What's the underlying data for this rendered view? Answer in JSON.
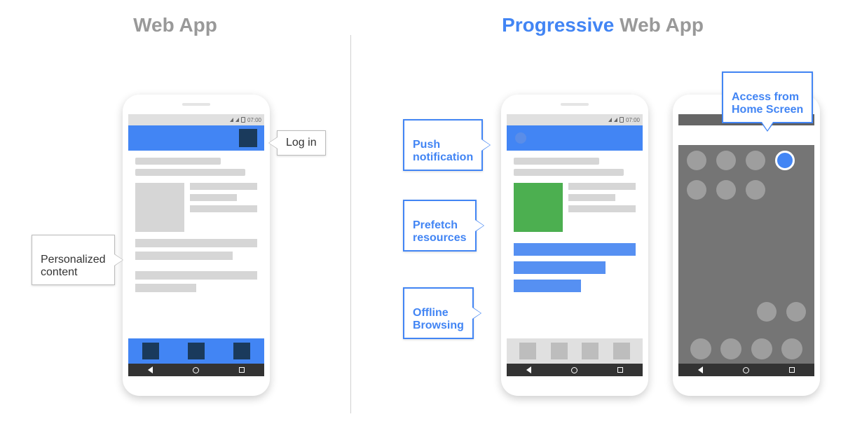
{
  "headings": {
    "left": "Web App",
    "right_highlight": "Progressive",
    "right_rest": " Web App"
  },
  "status": {
    "time": "07:00"
  },
  "callouts": {
    "login": "Log in",
    "personalized": "Personalized\ncontent",
    "push": "Push\nnotification",
    "prefetch": "Prefetch\nresources",
    "offline": "Offline\nBrowsing",
    "homescreen": "Access from\nHome Screen"
  }
}
